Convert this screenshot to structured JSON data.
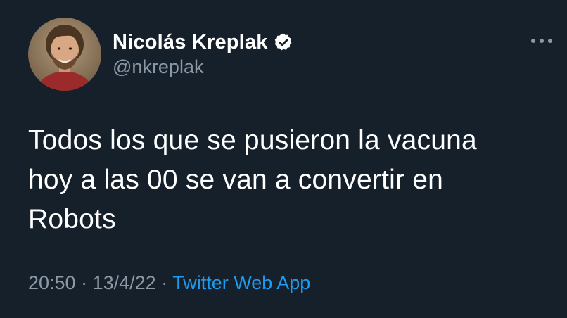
{
  "user": {
    "display_name": "Nicolás Kreplak",
    "handle": "@nkreplak",
    "verified_icon": "verified-badge-icon"
  },
  "tweet": {
    "text_lines": [
      "Todos los que se pusieron la vacuna",
      "hoy a las 00 se van a convertir en",
      "Robots"
    ],
    "time": "20:50",
    "separator": "·",
    "date": "13/4/22",
    "source": "Twitter Web App"
  },
  "colors": {
    "background": "#15202b",
    "text": "#ffffff",
    "secondary_text": "#8b98a5",
    "link": "#1d9bf0"
  }
}
